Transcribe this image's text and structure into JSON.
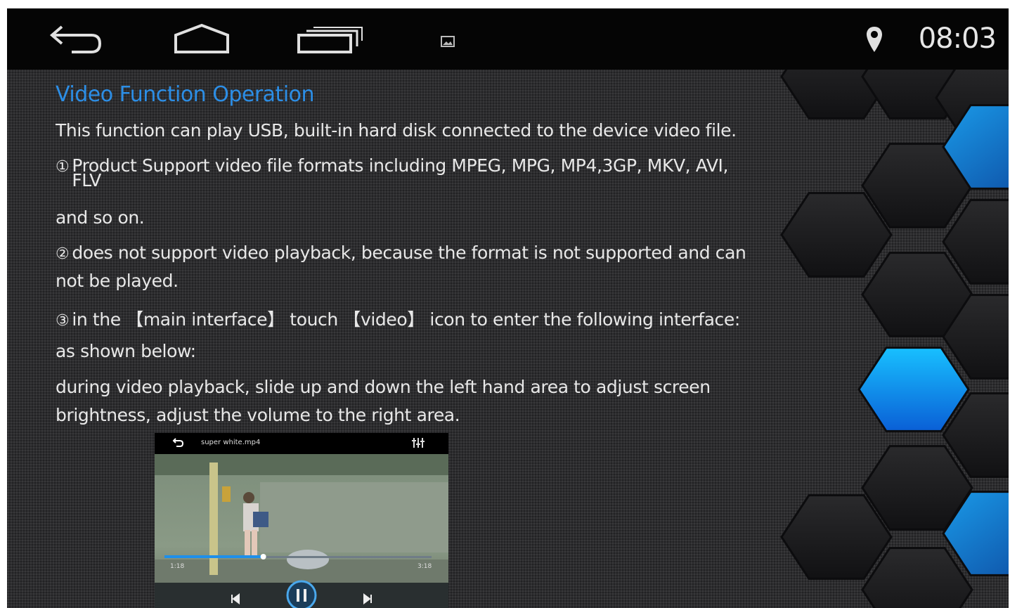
{
  "statusbar": {
    "icons": [
      "back-icon",
      "home-icon",
      "recent-apps-icon",
      "gallery-notification-icon",
      "location-pin-icon"
    ],
    "time": "08:03"
  },
  "document": {
    "title": "Video Function Operation",
    "intro": "This function can play USB, built-in hard disk connected to the device video file.",
    "item1_marker": "①",
    "item1_line1": "Product Support video file formats including MPEG, MPG, MP4,3GP, MKV, AVI,",
    "item1_line2": "FLV",
    "item1_line3": "and so on.",
    "item2_marker": "②",
    "item2_line1": "does not support video playback, because the format is not supported and can",
    "item2_line2": "not be played.",
    "item3_marker": "③",
    "item3_line1": "in the 【main interface】 touch 【video】 icon to enter the following interface:",
    "item3_line2": "as shown below:",
    "note_line1": "during video playback, slide up and down the left hand area to adjust screen",
    "note_line2": "brightness, adjust the volume to the right area."
  },
  "player": {
    "filename": "super white.mp4",
    "elapsed": "1:18",
    "duration": "3:18",
    "progress": 0.37,
    "icons": [
      "back-icon",
      "equalizer-icon",
      "previous-icon",
      "pause-icon",
      "next-icon"
    ]
  },
  "colors": {
    "title_blue": "#2c8ee6",
    "hex_blue": "#0d86e8",
    "statusbar": "#050505"
  }
}
